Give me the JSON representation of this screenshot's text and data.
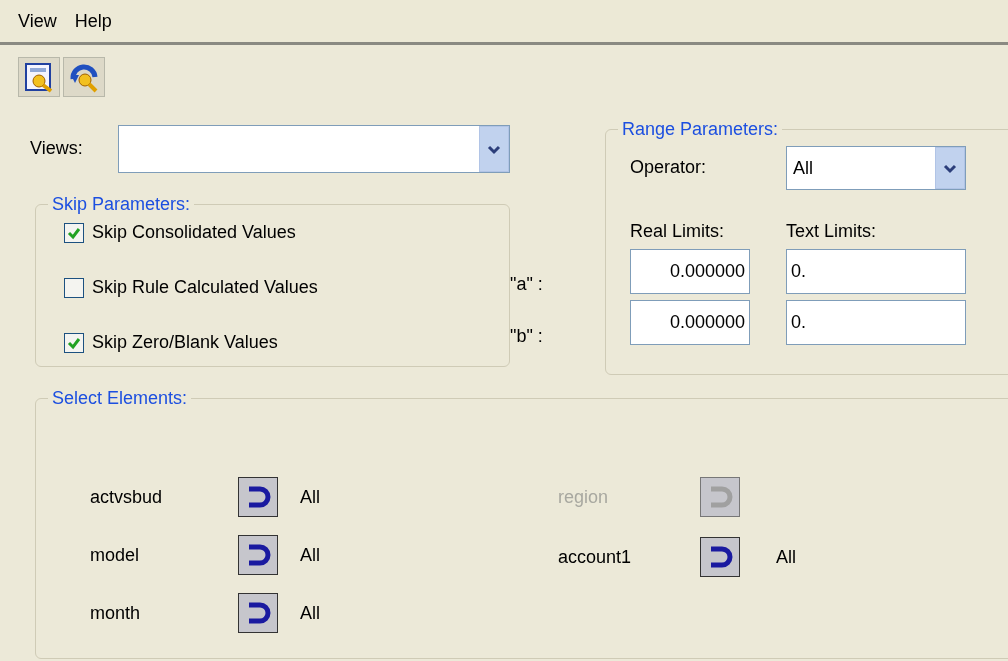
{
  "menu": [
    {
      "label": "View"
    },
    {
      "label": "Help"
    }
  ],
  "toolbar": [
    {
      "kind": "document"
    },
    {
      "kind": "refresh"
    }
  ],
  "views": {
    "label": "Views:"
  },
  "skip_parameters": {
    "title": "Skip Parameters:",
    "options": [
      {
        "label": "Skip Consolidated Values",
        "checked": true
      },
      {
        "label": "Skip Rule Calculated Values",
        "checked": false
      },
      {
        "label": "Skip Zero/Blank Values",
        "checked": true
      }
    ]
  },
  "range_parameters": {
    "title": "Range Parameters:",
    "operator_label": "Operator:",
    "operator_value": "All",
    "real_limits_label": "Real Limits:",
    "text_limits_label": "Text Limits:",
    "limits": [
      {
        "label": "\"a\" :",
        "real": "0.000000",
        "text": "0."
      },
      {
        "label": "\"b\" :",
        "real": "0.000000",
        "text": "0."
      }
    ]
  },
  "select_elements": {
    "title": "Select Elements:",
    "columns": [
      [
        {
          "label": "actvsbud",
          "value": "All",
          "disabled": false
        },
        {
          "label": "model",
          "value": "All",
          "disabled": false
        },
        {
          "label": "month",
          "value": "All",
          "disabled": false
        }
      ],
      [
        {
          "label": "region",
          "disabled": true
        },
        {
          "label": "account1",
          "value": "All",
          "disabled": false
        }
      ]
    ]
  }
}
